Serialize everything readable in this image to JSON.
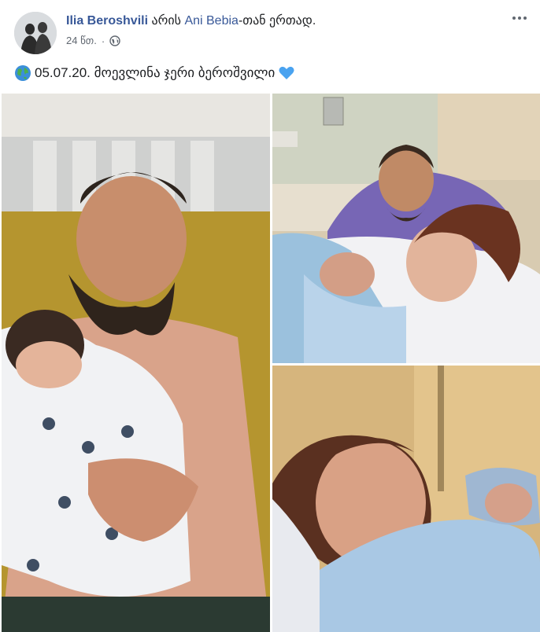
{
  "post": {
    "author": "Ilia Beroshvili",
    "action_text": " არის ",
    "tagged": "Ani Bebia",
    "action_suffix": "-თან ერთად.",
    "time": "24 წთ.",
    "separator": "·",
    "caption": "05.07.20. მოევლინა ჯერი ბეროშვილი"
  },
  "icons": {
    "globe": "globe-icon",
    "earth_emoji": "earth-emoji-icon",
    "heart_emoji": "blue-heart-icon",
    "more": "more-options-icon"
  },
  "colors": {
    "link": "#385898",
    "meta": "#606770",
    "heart": "#4aa3f0"
  }
}
